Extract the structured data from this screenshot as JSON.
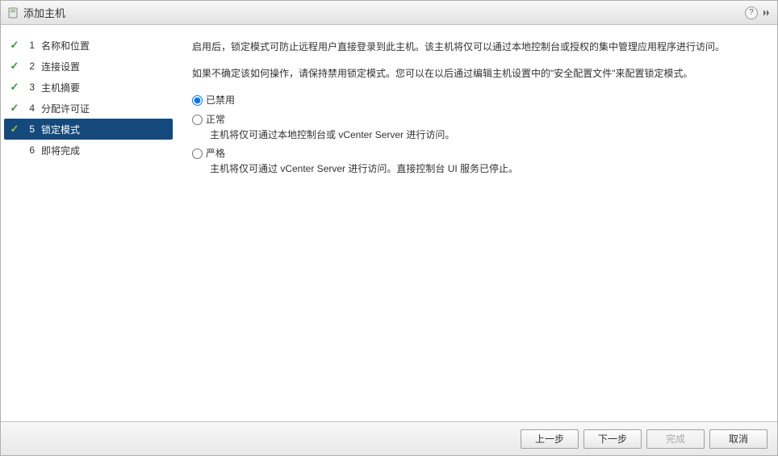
{
  "header": {
    "title": "添加主机"
  },
  "sidebar": {
    "steps": [
      {
        "num": "1",
        "label": "名称和位置",
        "status": "done"
      },
      {
        "num": "2",
        "label": "连接设置",
        "status": "done"
      },
      {
        "num": "3",
        "label": "主机摘要",
        "status": "done"
      },
      {
        "num": "4",
        "label": "分配许可证",
        "status": "done"
      },
      {
        "num": "5",
        "label": "锁定模式",
        "status": "active"
      },
      {
        "num": "6",
        "label": "即将完成",
        "status": "pending"
      }
    ]
  },
  "content": {
    "paragraph1": "启用后，锁定模式可防止远程用户直接登录到此主机。该主机将仅可以通过本地控制台或授权的集中管理应用程序进行访问。",
    "paragraph2": "如果不确定该如何操作，请保持禁用锁定模式。您可以在以后通过编辑主机设置中的\"安全配置文件\"来配置锁定模式。",
    "options": [
      {
        "label": "已禁用",
        "desc": "",
        "checked": true
      },
      {
        "label": "正常",
        "desc": "主机将仅可通过本地控制台或 vCenter Server 进行访问。",
        "checked": false
      },
      {
        "label": "严格",
        "desc": "主机将仅可通过 vCenter Server 进行访问。直接控制台 UI 服务已停止。",
        "checked": false
      }
    ]
  },
  "footer": {
    "back": "上一步",
    "next": "下一步",
    "finish": "完成",
    "cancel": "取消"
  }
}
